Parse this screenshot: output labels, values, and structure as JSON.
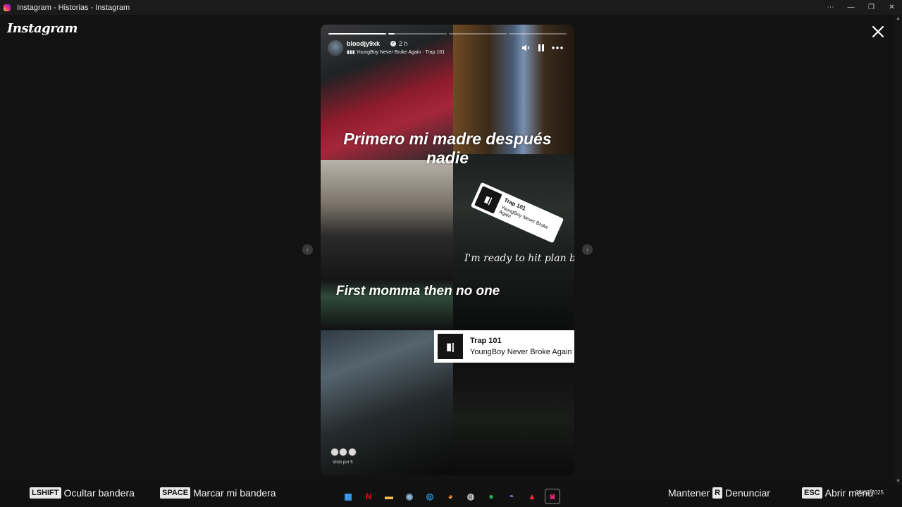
{
  "window": {
    "title": "Instagram - Historias - Instagram",
    "controls": [
      "⋯",
      "—",
      "❐",
      "✕"
    ]
  },
  "brand": {
    "logo_text": "Instagram"
  },
  "story": {
    "username": "bloodjy9xk",
    "time_ago": "2 h",
    "song_line": "YoungBoy Never Broke Again · Trap 101",
    "caption_top": "Primero mi madre después nadie",
    "caption_bottom": "First momma then no one",
    "lyric_line": "I'm ready to hit plan b",
    "sticker_rotated": {
      "title": "Trap 101",
      "artist": "YoungBoy Never Broke Again"
    },
    "music_card": {
      "title": "Trap 101",
      "artist": "YoungBoy Never Broke Again"
    },
    "seen_by": "Visto por 5",
    "progress": {
      "segments": 4,
      "current_index": 2,
      "current_fraction": 0.1
    },
    "icons": [
      "mute-icon",
      "pause-icon",
      "more-icon",
      "verified-icon"
    ]
  },
  "nav": {
    "prev": "‹",
    "next": "›"
  },
  "hints": [
    {
      "key": "LSHIFT",
      "label": "Ocultar bandera"
    },
    {
      "key": "SPACE",
      "label": "Marcar mi bandera"
    },
    {
      "pre": "Mantener",
      "key": "R",
      "label": "Denunciar"
    },
    {
      "key": "ESC",
      "label": "Abrir menú"
    }
  ],
  "taskbar": {
    "date": "28/12/2025",
    "icons": [
      "windows-icon",
      "netflix-icon",
      "folder-icon",
      "steam-icon",
      "safari-icon",
      "firefox-icon",
      "github-icon",
      "spotify-icon",
      "discord-icon",
      "adobe-icon",
      "instagram-icon"
    ]
  }
}
